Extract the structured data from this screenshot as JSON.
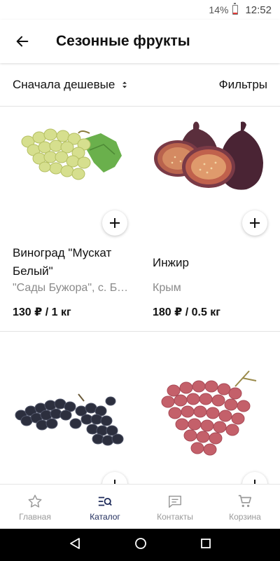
{
  "status": {
    "battery": "14%",
    "battery_level": 0.14,
    "time": "12:52"
  },
  "header": {
    "title": "Сезонные фрукты"
  },
  "toolbar": {
    "sort_label": "Сначала дешевые",
    "filters_label": "Фильтры"
  },
  "products": [
    {
      "name": "Виноград \"Мускат Белый\"",
      "origin": "\"Сады Бужора\", с. Бужор",
      "price": "130 ₽ / 1 кг"
    },
    {
      "name": "Инжир",
      "origin": "Крым",
      "price": "180 ₽ / 0.5 кг"
    },
    {
      "name": "",
      "origin": "",
      "price": ""
    },
    {
      "name": "",
      "origin": "",
      "price": ""
    }
  ],
  "bottom_nav": [
    {
      "label": "Главная",
      "icon": "star-icon"
    },
    {
      "label": "Каталог",
      "icon": "catalog-icon",
      "active": true
    },
    {
      "label": "Контакты",
      "icon": "chat-icon"
    },
    {
      "label": "Корзина",
      "icon": "cart-icon"
    }
  ],
  "colors": {
    "accent": "#1d2a5a",
    "inactive": "#999999",
    "battery_low": "#e53935"
  }
}
